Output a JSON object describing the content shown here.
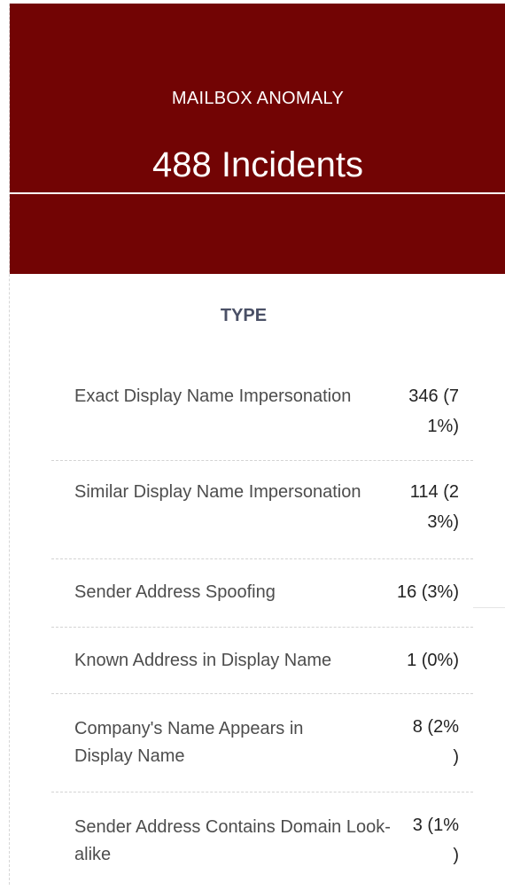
{
  "card": {
    "category": "MAILBOX ANOMALY",
    "incident_count": "488 Incidents",
    "header_color": "#720404"
  },
  "section": {
    "title": "TYPE"
  },
  "rows": [
    {
      "label": "Exact Display Name Impersonation",
      "value": "346 (71%)"
    },
    {
      "label": "Similar Display Name Impersonation",
      "value": "114 (23%)"
    },
    {
      "label": "Sender Address Spoofing",
      "value": "16 (3%)"
    },
    {
      "label": "Known Address in Display Name",
      "value": "1 (0%)"
    },
    {
      "label": "Company's Name Appears in Display Name",
      "value": "8 (2% )"
    },
    {
      "label": "Sender Address Contains Domain Look-alike",
      "value": "3 (1% )"
    }
  ]
}
